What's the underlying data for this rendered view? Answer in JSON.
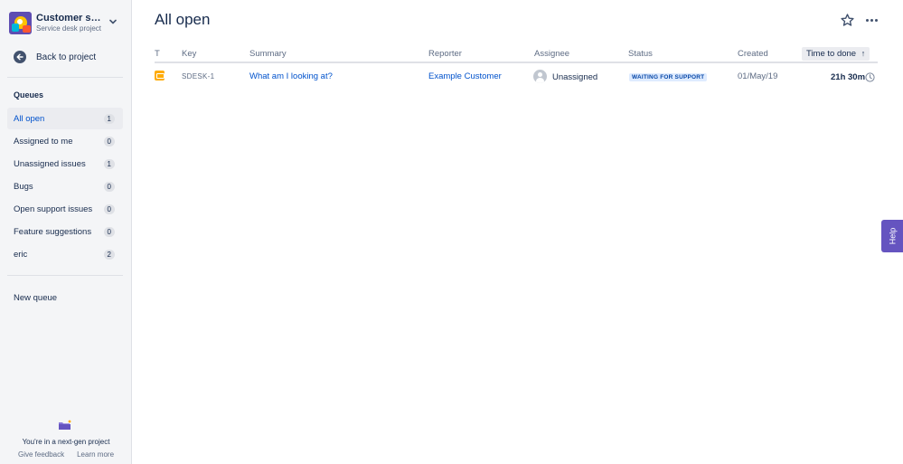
{
  "sidebar": {
    "project_name": "Customer service",
    "project_type": "Service desk project",
    "back_label": "Back to project",
    "queues_heading": "Queues",
    "queues": [
      {
        "label": "All open",
        "count": "1"
      },
      {
        "label": "Assigned to me",
        "count": "0"
      },
      {
        "label": "Unassigned issues",
        "count": "1"
      },
      {
        "label": "Bugs",
        "count": "0"
      },
      {
        "label": "Open support issues",
        "count": "0"
      },
      {
        "label": "Feature suggestions",
        "count": "0"
      },
      {
        "label": "eric",
        "count": "2"
      }
    ],
    "new_queue_label": "New queue",
    "footer_text": "You're in a next-gen project",
    "give_feedback": "Give feedback",
    "learn_more": "Learn more"
  },
  "main": {
    "title": "All open",
    "columns": {
      "type": "T",
      "key": "Key",
      "summary": "Summary",
      "reporter": "Reporter",
      "assignee": "Assignee",
      "status": "Status",
      "created": "Created",
      "time_to_done": "Time to done",
      "sort_indicator": "↑"
    },
    "rows": [
      {
        "type_icon": "service-request-icon",
        "key": "SDESK-1",
        "summary": "What am I looking at?",
        "reporter": "Example Customer",
        "assignee": "Unassigned",
        "status": "WAITING FOR SUPPORT",
        "created": "01/May/19",
        "time_to_done": "21h 30m"
      }
    ]
  },
  "help_label": "Help",
  "colors": {
    "accent": "#0052cc",
    "sidebar_bg": "#f4f5f7",
    "status_bg": "#deebff",
    "status_text": "#0747a6",
    "help_bg": "#6554c0",
    "type_icon": "#ffab00"
  }
}
